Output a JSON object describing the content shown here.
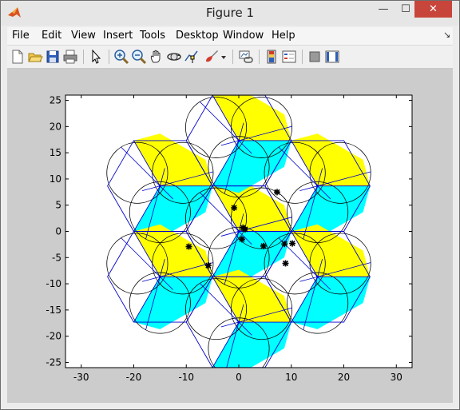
{
  "window": {
    "title": "Figure 1",
    "minimize_glyph": "—",
    "maximize_glyph": "☐",
    "close_glyph": "✕"
  },
  "menus": [
    "File",
    "Edit",
    "View",
    "Insert",
    "Tools",
    "Desktop",
    "Window",
    "Help"
  ],
  "dock_arrow": "↘",
  "toolbar_icons": [
    "new-figure-icon",
    "open-file-icon",
    "save-icon",
    "print-icon",
    "edit-plot-icon",
    "zoom-in-icon",
    "zoom-out-icon",
    "pan-icon",
    "rotate-3d-icon",
    "data-cursor-icon",
    "brush-icon",
    "brush-menu-icon",
    "link-plot-icon",
    "colorbar-icon",
    "legend-icon",
    "hide-plot-tools-icon",
    "show-plot-tools-icon"
  ],
  "colors": {
    "yellow": "#ffff00",
    "cyan": "#00ffff",
    "edge": "#0000cc",
    "circle": "#000000",
    "background": "#cccccc"
  },
  "chart_data": {
    "type": "scatter",
    "title": "",
    "xlabel": "",
    "ylabel": "",
    "xlim": [
      -33,
      33
    ],
    "ylim": [
      -26,
      26
    ],
    "xticks": [
      -30,
      -20,
      -10,
      0,
      10,
      20,
      30
    ],
    "yticks": [
      -25,
      -20,
      -15,
      -10,
      -5,
      0,
      5,
      10,
      15,
      20,
      25
    ],
    "grid": false,
    "cell_radius": 10,
    "cells": [
      {
        "cx": 0,
        "cy": 0
      },
      {
        "cx": 0,
        "cy": 17.32
      },
      {
        "cx": 0,
        "cy": -17.32
      },
      {
        "cx": 15,
        "cy": 8.66
      },
      {
        "cx": 15,
        "cy": -8.66
      },
      {
        "cx": -15,
        "cy": 8.66
      },
      {
        "cx": -15,
        "cy": -8.66
      }
    ],
    "sectors": [
      {
        "name": "sector-1",
        "from_deg": 0,
        "to_deg": 120,
        "color": "yellow"
      },
      {
        "name": "sector-2",
        "from_deg": 240,
        "to_deg": 360,
        "color": "cyan"
      }
    ],
    "users": [
      {
        "x": -9.5,
        "y": -2.9
      },
      {
        "x": -5.8,
        "y": -6.5
      },
      {
        "x": -0.9,
        "y": 4.5
      },
      {
        "x": 0.8,
        "y": 0.7
      },
      {
        "x": 1.2,
        "y": 0.4
      },
      {
        "x": 0.6,
        "y": -1.5
      },
      {
        "x": 4.7,
        "y": -2.8
      },
      {
        "x": 7.3,
        "y": 7.5
      },
      {
        "x": 8.7,
        "y": -2.4
      },
      {
        "x": 10.2,
        "y": -2.3
      },
      {
        "x": 8.9,
        "y": -6.1
      }
    ]
  }
}
